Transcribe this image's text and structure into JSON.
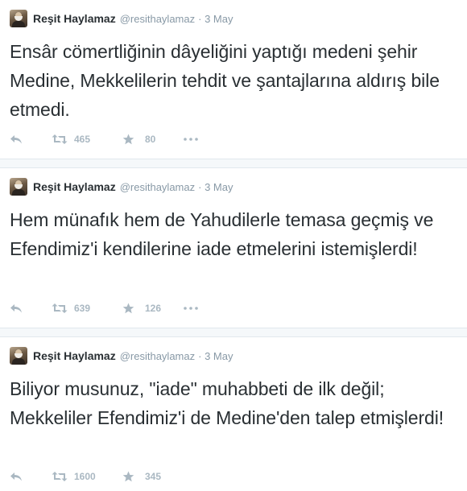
{
  "tweets": [
    {
      "author_name": "Reşit Haylamaz",
      "handle": "@resithaylamaz",
      "date": "· 3 May",
      "text": "Ensâr cömertliğinin dâyeliğini yaptığı medeni şehir Medine, Mekkelilerin tehdit ve şantajlarına aldırış bile etmedi.",
      "retweets": "465",
      "favorites": "80"
    },
    {
      "author_name": "Reşit Haylamaz",
      "handle": "@resithaylamaz",
      "date": "· 3 May",
      "text": "Hem münafık hem de Yahudilerle temasa geçmiş ve Efendimiz'i kendilerine iade etmelerini istemişlerdi!",
      "retweets": "639",
      "favorites": "126"
    },
    {
      "author_name": "Reşit Haylamaz",
      "handle": "@resithaylamaz",
      "date": "· 3 May",
      "text": "Biliyor musunuz, \"iade\" muhabbeti de ilk değil; Mekkeliler Efendimiz'i de Medine'den talep etmişlerdi!",
      "retweets": "1600",
      "favorites": "345"
    }
  ],
  "icons": {
    "reply": "reply-icon",
    "retweet": "retweet-icon",
    "favorite": "star-icon",
    "more": "more-icon"
  },
  "colors": {
    "text": "#292f33",
    "muted": "#8899a6",
    "icon": "#aab8c2",
    "separator": "#f5f8fa"
  }
}
